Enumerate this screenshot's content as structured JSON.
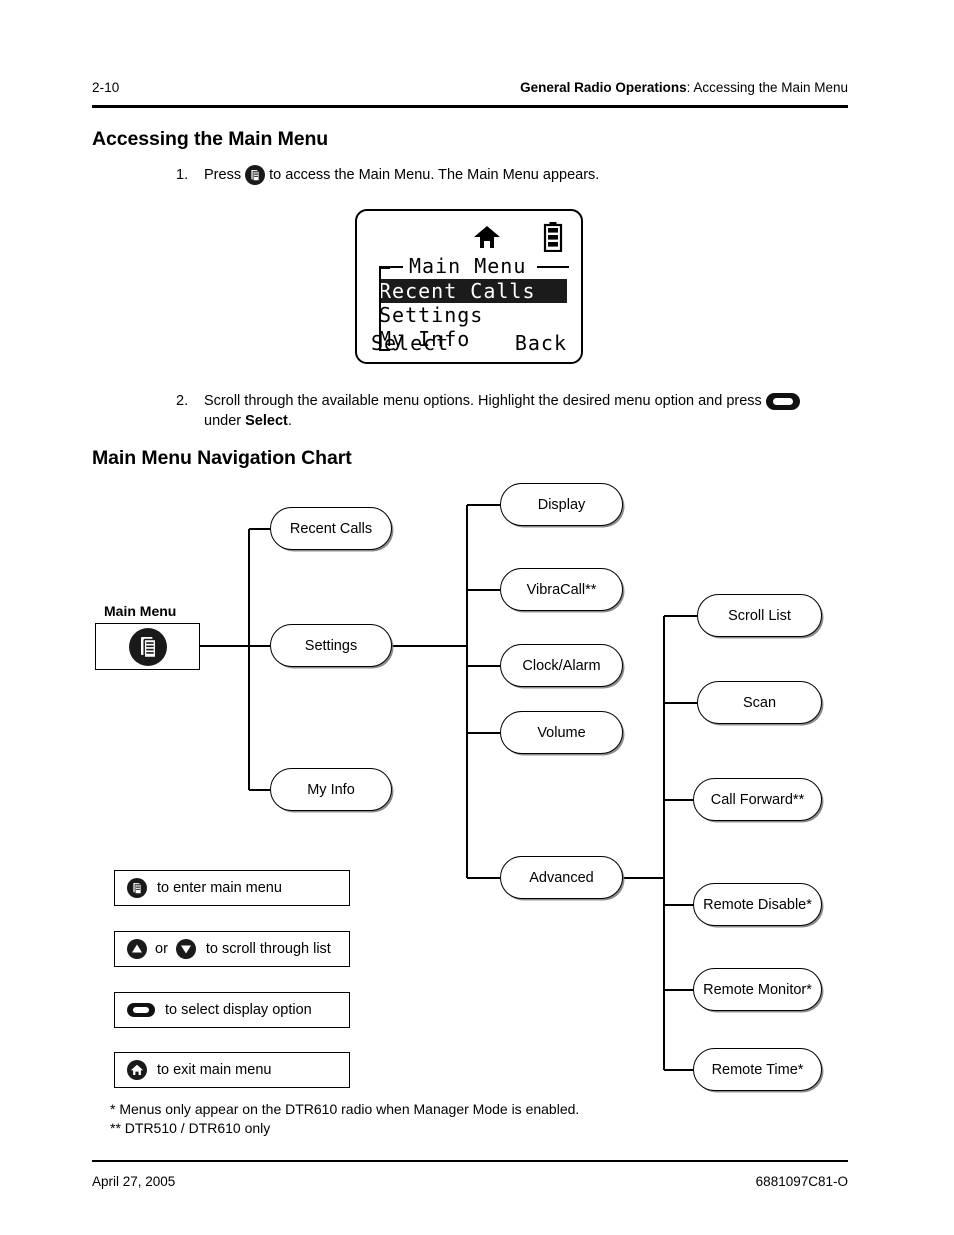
{
  "header": {
    "page_number": "2-10",
    "section_bold": "General Radio Operations",
    "section_rest": ": Accessing the Main Menu"
  },
  "headings": {
    "accessing": "Accessing the Main Menu",
    "nav_chart": "Main Menu Navigation Chart"
  },
  "steps": [
    {
      "number": "1.",
      "text_before": "Press",
      "icon": "menu-key-icon",
      "text_after": "to access the Main Menu. The Main Menu appears."
    },
    {
      "number": "2.",
      "text_before": "Scroll through the available menu options. Highlight the desired menu option and press",
      "icon": "select-key-icon",
      "text_after": "under",
      "bold_word": "Select",
      "text_end": "."
    }
  ],
  "radio_display": {
    "status_icons": [
      "home-icon",
      "battery-icon"
    ],
    "title": "Main Menu",
    "items": [
      {
        "label": "Recent Calls",
        "highlighted": true
      },
      {
        "label": "Settings",
        "highlighted": false
      },
      {
        "label": "My Info",
        "highlighted": false
      }
    ],
    "softkey_left": "Select",
    "softkey_right": "Back"
  },
  "nav_chart": {
    "root": {
      "label": "Main Menu",
      "icon": "menu-key-icon"
    },
    "level1": [
      {
        "label": "Recent Calls"
      },
      {
        "label": "Settings"
      },
      {
        "label": "My Info"
      }
    ],
    "level2": [
      {
        "label": "Display"
      },
      {
        "label": "VibraCall**"
      },
      {
        "label": "Clock/Alarm"
      },
      {
        "label": "Volume"
      },
      {
        "label": "Advanced"
      }
    ],
    "level3": [
      {
        "label": "Scroll List"
      },
      {
        "label": "Scan"
      },
      {
        "label": "Call Forward**"
      },
      {
        "label": "Remote Disable*"
      },
      {
        "label": "Remote Monitor*"
      },
      {
        "label": "Remote Time*"
      }
    ]
  },
  "legend": [
    {
      "icon": "menu-key-icon",
      "text": "to enter main menu"
    },
    {
      "icon_up": "up-arrow-key-icon",
      "conjunction": "or",
      "icon_down": "down-arrow-key-icon",
      "text": "to scroll through list"
    },
    {
      "icon": "select-key-icon",
      "text": "to select display option"
    },
    {
      "icon": "home-key-icon",
      "text": "to exit main menu"
    }
  ],
  "footnotes": [
    "* Menus only appear on the DTR610 radio when Manager Mode is enabled.",
    "** DTR510 / DTR610 only"
  ],
  "footer": {
    "left": "April 27, 2005",
    "right": "6881097C81-O"
  },
  "colors": {
    "ink": "#000000",
    "key_fill": "#1a1a1a",
    "highlight_bg": "#1b1b1b",
    "page_bg": "#ffffff"
  }
}
